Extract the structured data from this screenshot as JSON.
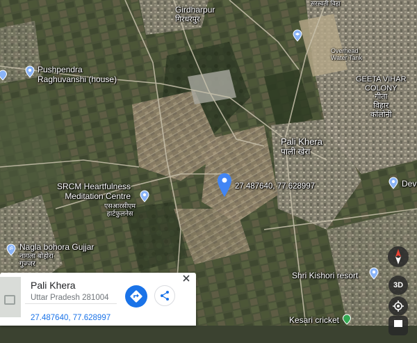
{
  "map": {
    "places": {
      "girdharpur": {
        "name": "Girdharpur",
        "local": "गिरधरपुर"
      },
      "top_local": "सरस्वती विहा",
      "pushpendra": {
        "line1": "Pushpendra",
        "line2": "Raghuvanshi (house)"
      },
      "geeta_vihar": {
        "line1": "GEETA VIHAR",
        "line2": "COLONY",
        "local1": "गीता",
        "local2": "विहार",
        "local3": "कॉलोनी"
      },
      "pali_khera": {
        "name": "Pali Khera",
        "local": "पाली खेरा"
      },
      "srcm": {
        "line1": "SRCM Heartfulness",
        "line2": "Meditation Centre",
        "local1": "एसआरसीएम",
        "local2": "हार्टफुलनेस"
      },
      "dev": {
        "name": "Dev"
      },
      "nagla": {
        "line1": "Nagla bohora Gujjar",
        "local1": "नागला बोहोरा",
        "local2": "गुज्जर"
      },
      "shri_kishori": {
        "name": "Shri Kishori resort"
      },
      "kesari": {
        "name": "Kesari cricket"
      },
      "overhead": {
        "line1": "Overhead",
        "line2": "Water Tank"
      }
    },
    "dropped_pin": {
      "coords": "27.487640, 77.628997"
    },
    "colors": {
      "pin_blue": "#4285f4",
      "water_blue": "#1a73e8"
    }
  },
  "place_card": {
    "title": "Pali Khera",
    "address": "Uttar Pradesh 281004",
    "coords": "27.487640, 77.628997",
    "close_icon": "close-icon",
    "directions_icon": "directions-icon",
    "share_icon": "share-icon"
  },
  "controls": {
    "compass_icon": "compass-icon",
    "three_d": "3D",
    "location_icon": "my-location-icon",
    "layers_icon": "layers-icon"
  }
}
